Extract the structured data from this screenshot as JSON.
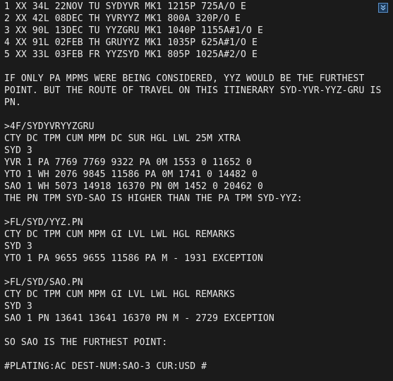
{
  "lines": [
    "1 XX 34L 22NOV TU SYDYVR MK1 1215P 725A/O E",
    "2 XX 42L 08DEC TH YVRYYZ MK1 800A 320P/O E",
    "3 XX 90L 13DEC TU YYZGRU MK1 1040P 1155A#1/O E",
    "4 XX 91L 02FEB TH GRUYYZ MK1 1035P 625A#1/O E",
    "5 XX 33L 03FEB FR YYZSYD MK1 805P 1025A#2/O E",
    "",
    "IF ONLY PA MPMS WERE BEING CONSIDERED, YYZ WOULD BE THE FURTHEST",
    "POINT. BUT THE ROUTE OF TRAVEL ON THIS ITINERARY SYD-YVR-YYZ-GRU IS",
    "PN.",
    "",
    ">4F/SYDYVRYYZGRU",
    "CTY DC TPM CUM MPM DC SUR HGL LWL 25M XTRA",
    "SYD 3",
    "YVR 1 PA 7769 7769 9322 PA 0M 1553 0 11652 0",
    "YTO 1 WH 2076 9845 11586 PA 0M 1741 0 14482 0",
    "SAO 1 WH 5073 14918 16370 PN 0M 1452 0 20462 0",
    "THE PN TPM SYD-SAO IS HIGHER THAN THE PA TPM SYD-YYZ:",
    "",
    ">FL/SYD/YYZ.PN",
    "CTY DC TPM CUM MPM GI LVL LWL HGL REMARKS",
    "SYD 3",
    "YTO 1 PA 9655 9655 11586 PA M - 1931 EXCEPTION",
    "",
    ">FL/SYD/SAO.PN",
    "CTY DC TPM CUM MPM GI LVL LWL HGL REMARKS",
    "SYD 3",
    "SAO 1 PN 13641 13641 16370 PN M - 2729 EXCEPTION",
    "",
    "SO SAO IS THE FURTHEST POINT:",
    "",
    "#PLATING:AC DEST-NUM:SAO-3 CUR:USD #"
  ],
  "scroll_button_icon": "chevron-double-down-icon"
}
